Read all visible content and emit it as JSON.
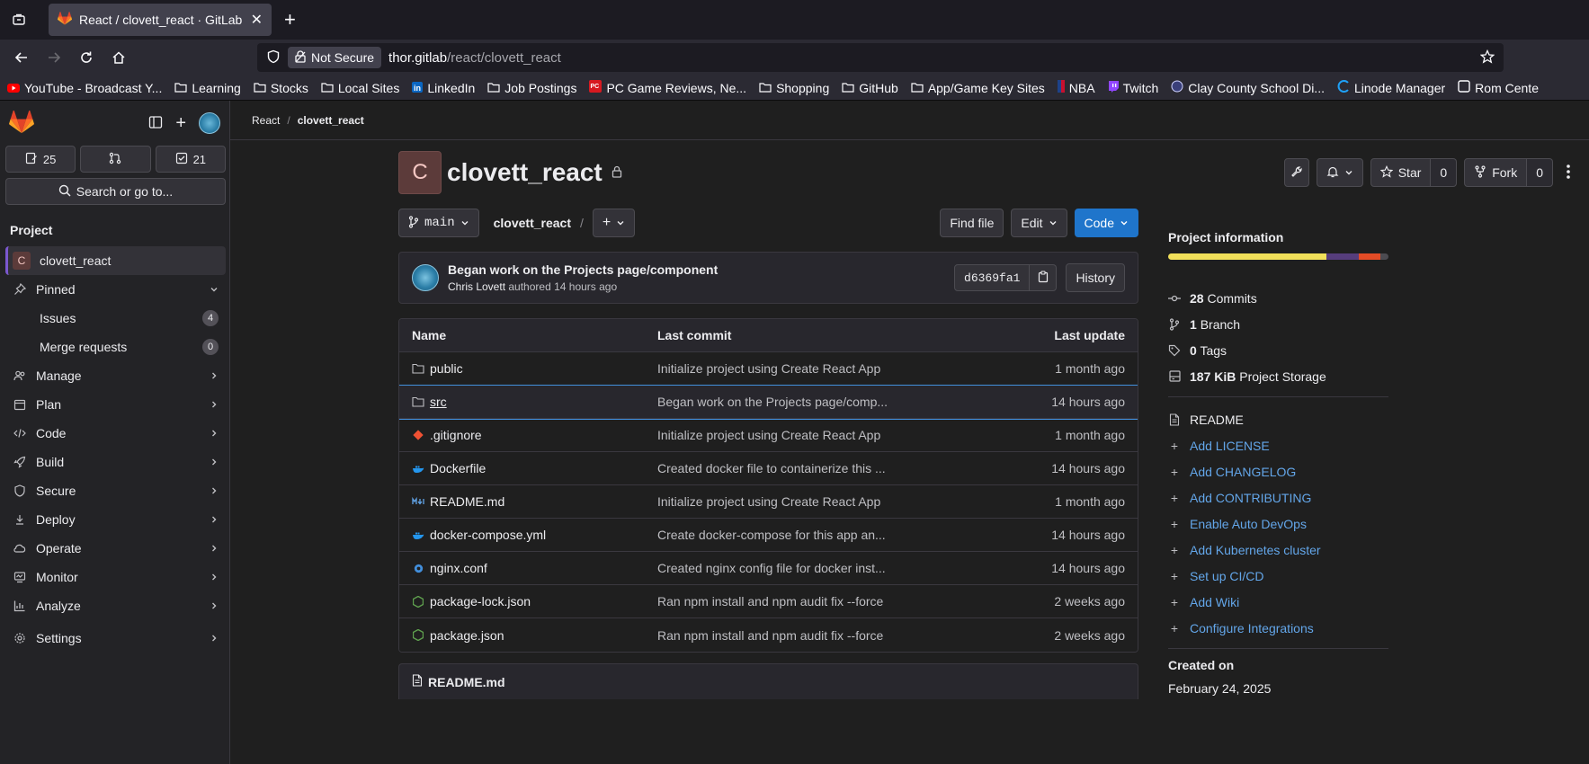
{
  "browser": {
    "tab_title": "React / clovett_react · GitLab",
    "not_secure": "Not Secure",
    "url_host": "thor.gitlab",
    "url_path": "/react/clovett_react",
    "bookmarks": [
      "YouTube - Broadcast Y...",
      "Learning",
      "Stocks",
      "Local Sites",
      "LinkedIn",
      "Job Postings",
      "PC Game Reviews, Ne...",
      "Shopping",
      "GitHub",
      "App/Game Key Sites",
      "NBA",
      "Twitch",
      "Clay County School Di...",
      "Linode Manager",
      "Rom Cente"
    ]
  },
  "sidebar": {
    "counts": {
      "issues": "25",
      "todos": "21"
    },
    "search_label": "Search or go to...",
    "heading": "Project",
    "project_name": "clovett_react",
    "project_initial": "C",
    "pinned": "Pinned",
    "issues": {
      "label": "Issues",
      "count": "4"
    },
    "merge_requests": {
      "label": "Merge requests",
      "count": "0"
    },
    "nav": [
      "Manage",
      "Plan",
      "Code",
      "Build",
      "Secure",
      "Deploy",
      "Operate",
      "Monitor",
      "Analyze",
      "Settings"
    ]
  },
  "breadcrumb": {
    "group": "React",
    "sep": "/",
    "project": "clovett_react"
  },
  "project": {
    "initial": "C",
    "name": "clovett_react",
    "star_label": "Star",
    "star_count": "0",
    "fork_label": "Fork",
    "fork_count": "0"
  },
  "repo": {
    "branch": "main",
    "path": "clovett_react",
    "path_sep": "/",
    "find_file": "Find file",
    "edit": "Edit",
    "code": "Code"
  },
  "commit": {
    "title": "Began work on the Projects page/component",
    "author": "Chris Lovett",
    "meta": "authored 14 hours ago",
    "sha": "d6369fa1",
    "history": "History"
  },
  "files": {
    "headers": {
      "name": "Name",
      "last_commit": "Last commit",
      "last_update": "Last update"
    },
    "rows": [
      {
        "name": "public",
        "commit": "Initialize project using Create React App",
        "update": "1 month ago"
      },
      {
        "name": "src",
        "commit": "Began work on the Projects page/comp...",
        "update": "14 hours ago"
      },
      {
        "name": ".gitignore",
        "commit": "Initialize project using Create React App",
        "update": "1 month ago"
      },
      {
        "name": "Dockerfile",
        "commit": "Created docker file to containerize this ...",
        "update": "14 hours ago"
      },
      {
        "name": "README.md",
        "commit": "Initialize project using Create React App",
        "update": "1 month ago"
      },
      {
        "name": "docker-compose.yml",
        "commit": "Create docker-compose for this app an...",
        "update": "14 hours ago"
      },
      {
        "name": "nginx.conf",
        "commit": "Created nginx config file for docker inst...",
        "update": "14 hours ago"
      },
      {
        "name": "package-lock.json",
        "commit": "Ran npm install and npm audit fix --force",
        "update": "2 weeks ago"
      },
      {
        "name": "package.json",
        "commit": "Ran npm install and npm audit fix --force",
        "update": "2 weeks ago"
      }
    ]
  },
  "readme_title": "README.md",
  "project_info": {
    "title": "Project information",
    "lang_colors": [
      "#f1e05a",
      "#563d7c",
      "#e34c26",
      "#4c4b51"
    ],
    "commits_count": "28",
    "commits_label": "Commits",
    "branch_count": "1",
    "branch_label": "Branch",
    "tags_count": "0",
    "tags_label": "Tags",
    "storage_size": "187 KiB",
    "storage_label": "Project Storage",
    "readme": "README",
    "links": [
      "Add LICENSE",
      "Add CHANGELOG",
      "Add CONTRIBUTING",
      "Enable Auto DevOps",
      "Add Kubernetes cluster",
      "Set up CI/CD",
      "Add Wiki",
      "Configure Integrations"
    ],
    "created_label": "Created on",
    "created_date": "February 24, 2025"
  }
}
